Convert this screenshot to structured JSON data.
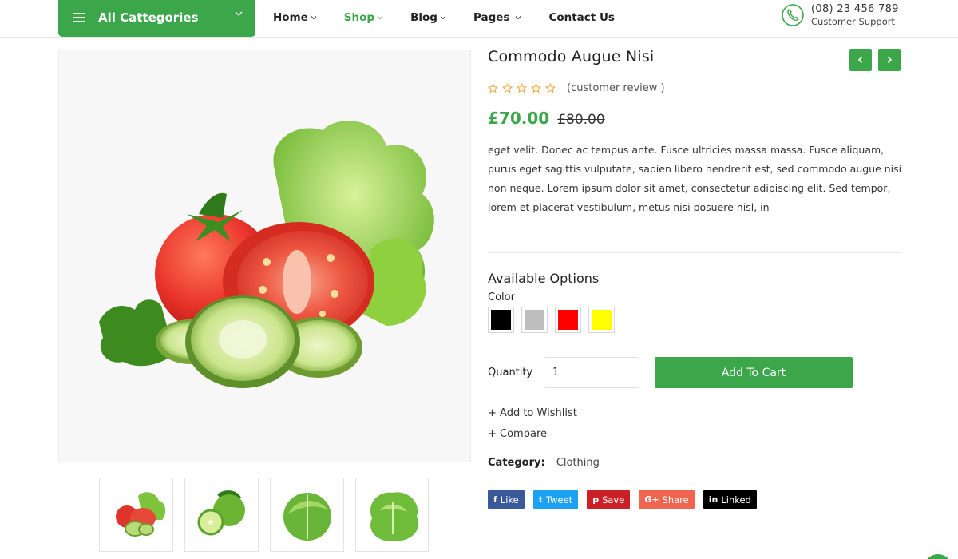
{
  "header": {
    "categories_label": "All Cattegories",
    "nav": [
      {
        "label": "Home"
      },
      {
        "label": "Shop"
      },
      {
        "label": "Blog"
      },
      {
        "label": "Pages"
      },
      {
        "label": "Contact Us"
      }
    ],
    "support_phone": "(08) 23 456 789",
    "support_label": "Customer Support"
  },
  "product": {
    "title": "Commodo Augue Nisi",
    "review_text": "(customer review )",
    "rating": 0,
    "price": "£70.00",
    "old_price": "£80.00",
    "description": "eget velit. Donec ac tempus ante. Fusce ultricies massa massa. Fusce aliquam, purus eget sagittis vulputate, sapien libero hendrerit est, sed commodo augue nisi non neque. Lorem ipsum dolor sit amet, consectetur adipiscing elit. Sed tempor, lorem et placerat vestibulum, metus nisi posuere nisl, in",
    "options_title": "Available Options",
    "color_label": "Color",
    "colors": [
      "#000000",
      "#bdbdbd",
      "#ff0000",
      "#ffff00"
    ],
    "quantity_label": "Quantity",
    "quantity_value": "1",
    "add_to_cart": "Add To Cart",
    "wishlist": "+ Add to Wishlist",
    "compare": "+ Compare",
    "category_key": "Category:",
    "category_value": "Clothing"
  },
  "share": [
    {
      "icon": "f",
      "label": "Like",
      "color": "#3b5998"
    },
    {
      "icon": "t",
      "label": "Tweet",
      "color": "#1da1f2"
    },
    {
      "icon": "p",
      "label": "Save",
      "color": "#cb2027"
    },
    {
      "icon": "G+",
      "label": "Share",
      "color": "#f0654f"
    },
    {
      "icon": "in",
      "label": "Linked",
      "color": "#000000"
    }
  ],
  "theme": {
    "accent": "#3ba74a"
  }
}
